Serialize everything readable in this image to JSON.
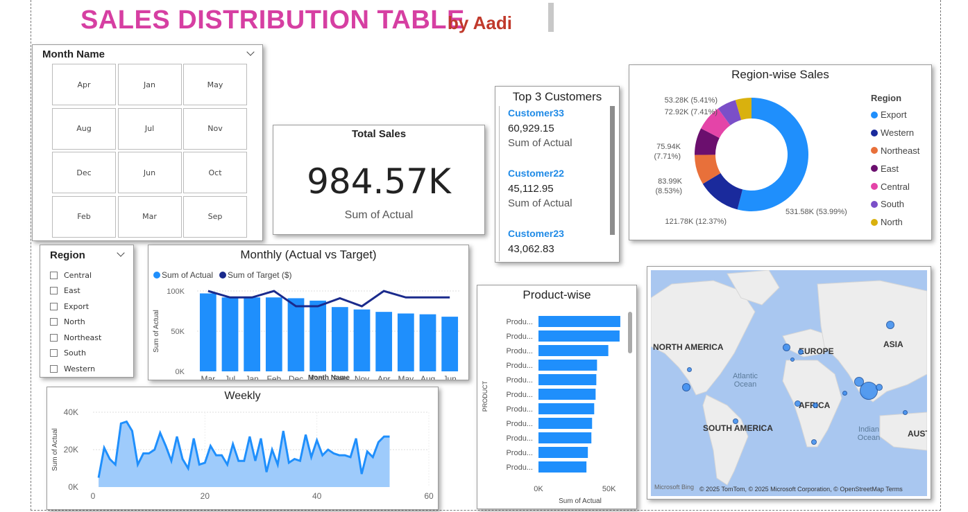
{
  "header": {
    "title": "SALES DISTRIBUTION TABLE",
    "byline": "by Aadi"
  },
  "month_slicer": {
    "title": "Month Name",
    "months": [
      "Apr",
      "Jan",
      "May",
      "Aug",
      "Jul",
      "Nov",
      "Dec",
      "Jun",
      "Oct",
      "Feb",
      "Mar",
      "Sep"
    ]
  },
  "total_sales": {
    "title": "Total Sales",
    "value": "984.57K",
    "label": "Sum of Actual"
  },
  "top_customers": {
    "title": "Top 3 Customers",
    "items": [
      {
        "name": "Customer33",
        "value": "60,929.15",
        "label": "Sum of Actual"
      },
      {
        "name": "Customer22",
        "value": "45,112.95",
        "label": "Sum of Actual"
      },
      {
        "name": "Customer23",
        "value": "43,062.83",
        "label": ""
      }
    ]
  },
  "region_slicer": {
    "title": "Region",
    "options": [
      "Central",
      "East",
      "Export",
      "North",
      "Northeast",
      "South",
      "Western"
    ]
  },
  "map": {
    "labels": {
      "north_america": "NORTH AMERICA",
      "europe": "EUROPE",
      "asia": "ASIA",
      "africa": "AFRICA",
      "south_america": "SOUTH AMERICA",
      "australia": "AUST",
      "atlantic": "Atlantic Ocean",
      "indian": "Indian Ocean"
    },
    "bing": "Microsoft Bing",
    "attribution": "© 2025 TomTom, © 2025 Microsoft Corporation, © OpenStreetMap  Terms"
  },
  "colors": {
    "actual": "#1f8ffc",
    "target": "#1a2a8c",
    "title_pink": "#d63fa2",
    "byline_red": "#c0392b"
  },
  "chart_data": [
    {
      "id": "region_donut",
      "type": "pie",
      "title": "Region-wise Sales",
      "legend_title": "Region",
      "legend_position": "right",
      "categories": [
        "Export",
        "Western",
        "Northeast",
        "East",
        "Central",
        "South",
        "North"
      ],
      "values": [
        531.58,
        121.78,
        83.99,
        75.94,
        72.92,
        53.28,
        45.08
      ],
      "colors": [
        "#1f8ffc",
        "#1a2a9c",
        "#e8703a",
        "#6b0f6e",
        "#e444a8",
        "#7b4fc8",
        "#d9b10e"
      ],
      "data_labels": [
        "531.58K (53.99%)",
        "121.78K (12.37%)",
        "83.99K (8.53%)",
        "75.94K (7.71%)",
        "72.92K (7.41%)",
        "53.28K (5.41%)",
        ""
      ]
    },
    {
      "id": "monthly",
      "type": "bar",
      "title": "Monthly (Actual vs Target)",
      "xlabel": "Month Name",
      "ylabel": "Sum of Actual",
      "ylim": [
        0,
        100000
      ],
      "yticks": [
        "0K",
        "50K",
        "100K"
      ],
      "legend_position": "top-left",
      "categories": [
        "Mar",
        "Jul",
        "Jan",
        "Feb",
        "Dec",
        "Oct",
        "Sep",
        "Nov",
        "Apr",
        "May",
        "Aug",
        "Jun"
      ],
      "series": [
        {
          "name": "Sum of Actual",
          "type": "bar",
          "values": [
            97000,
            92000,
            92000,
            92000,
            91000,
            88000,
            80000,
            77000,
            74000,
            72000,
            71000,
            68000
          ]
        },
        {
          "name": "Sum of Target ($)",
          "type": "line",
          "values": [
            100000,
            92000,
            92000,
            100000,
            81000,
            81000,
            91000,
            81000,
            100000,
            92000,
            92000,
            92000
          ]
        }
      ]
    },
    {
      "id": "product",
      "type": "bar",
      "orientation": "horizontal",
      "title": "Product-wise",
      "xlabel": "Sum of Actual",
      "ylabel": "PRODUCT",
      "xlim": [
        0,
        60000
      ],
      "xticks": [
        "0K",
        "50K"
      ],
      "categories": [
        "Produ...",
        "Produ...",
        "Produ...",
        "Produ...",
        "Produ...",
        "Produ...",
        "Produ...",
        "Produ...",
        "Produ...",
        "Produ...",
        "Produ..."
      ],
      "values": [
        58000,
        57500,
        49500,
        41500,
        41000,
        40500,
        39500,
        38000,
        37500,
        35000,
        34000
      ]
    },
    {
      "id": "weekly",
      "type": "area",
      "title": "Weekly",
      "ylabel": "Sum of Actual",
      "xlabel": "",
      "xlim": [
        0,
        60
      ],
      "ylim": [
        0,
        40000
      ],
      "xticks": [
        "0",
        "20",
        "40",
        "60"
      ],
      "yticks": [
        "0K",
        "20K",
        "40K"
      ],
      "x": [
        1,
        2,
        3,
        4,
        5,
        6,
        7,
        8,
        9,
        10,
        11,
        12,
        13,
        14,
        15,
        16,
        17,
        18,
        19,
        20,
        21,
        22,
        23,
        24,
        25,
        26,
        27,
        28,
        29,
        30,
        31,
        32,
        33,
        34,
        35,
        36,
        37,
        38,
        39,
        40,
        41,
        42,
        43,
        44,
        45,
        46,
        47,
        48,
        49,
        50,
        51,
        52,
        53
      ],
      "values": [
        5000,
        21000,
        15000,
        12000,
        34000,
        35000,
        30000,
        12000,
        18000,
        18000,
        20000,
        29000,
        22000,
        14000,
        27000,
        15000,
        10000,
        26000,
        12000,
        13000,
        22000,
        17000,
        17000,
        12000,
        23000,
        14000,
        14000,
        27000,
        14000,
        26000,
        8000,
        20000,
        12000,
        30000,
        13000,
        15000,
        14000,
        28000,
        16000,
        25000,
        17000,
        20000,
        18000,
        17000,
        17000,
        16000,
        26000,
        7000,
        19000,
        16000,
        24000,
        27000,
        27000
      ]
    }
  ]
}
